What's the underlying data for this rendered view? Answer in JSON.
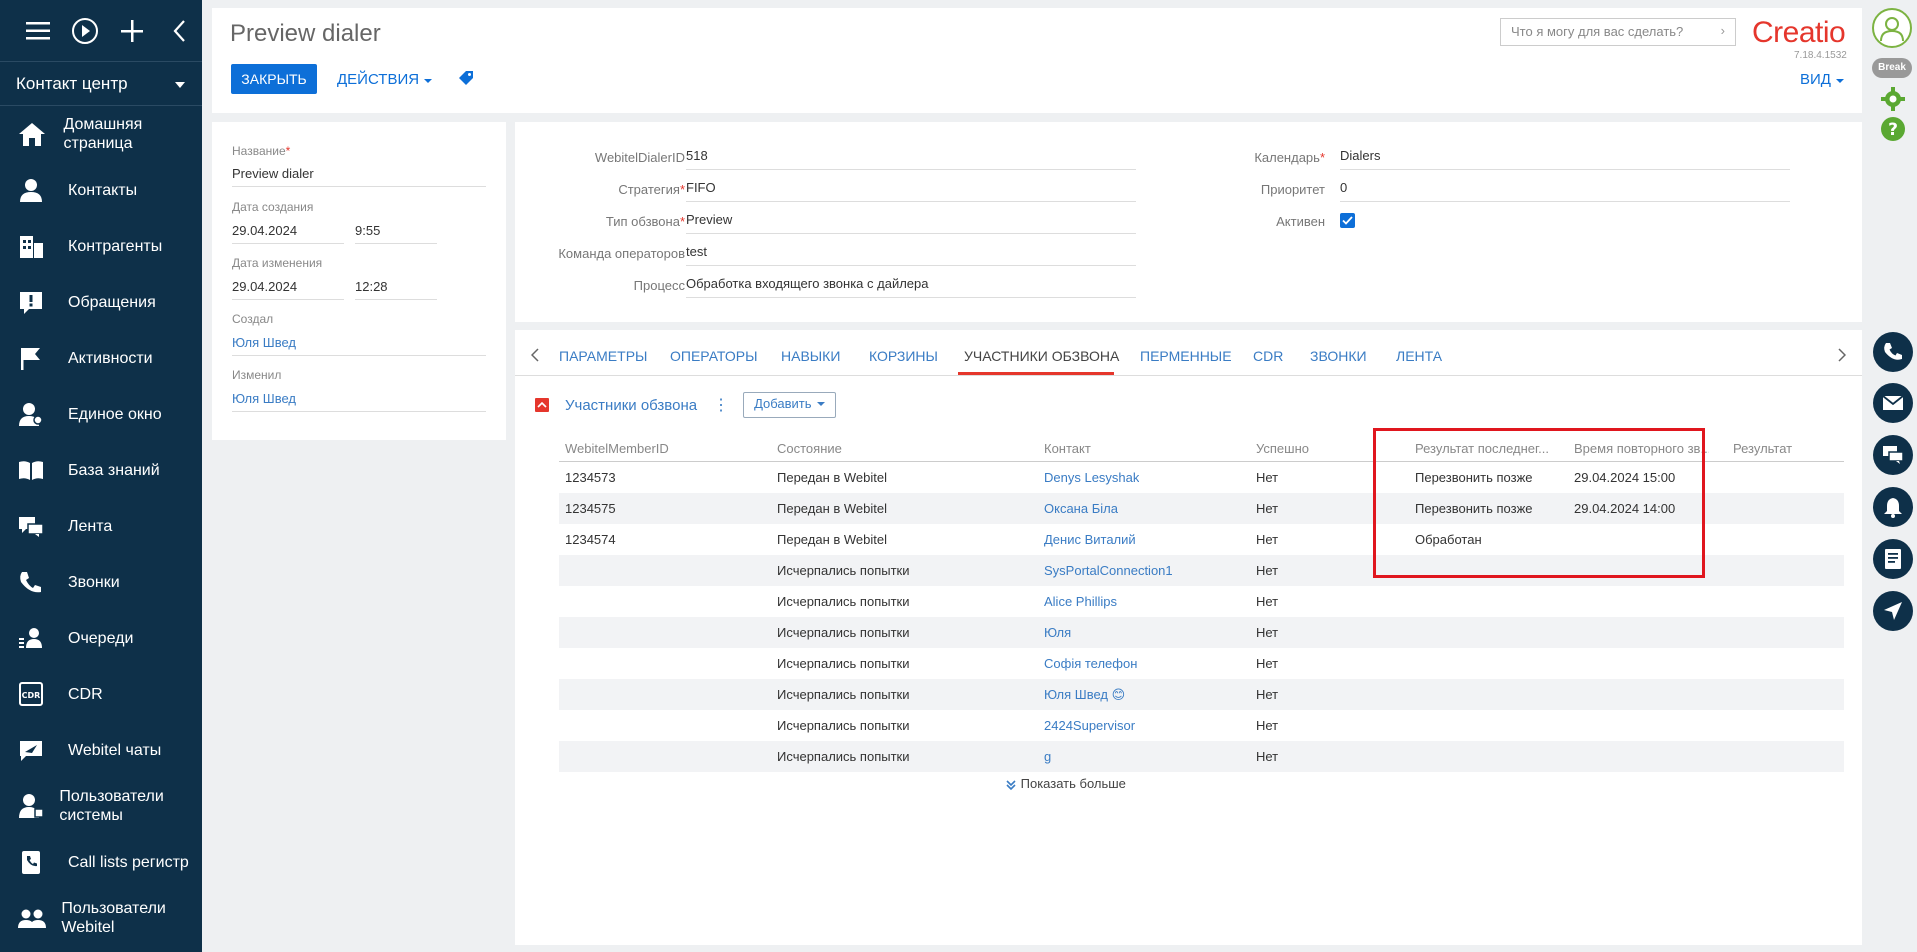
{
  "sidebar": {
    "workplace": "Контакт центр",
    "items": [
      {
        "label": "Домашняя страница",
        "icon": "home-icon"
      },
      {
        "label": "Контакты",
        "icon": "person-icon"
      },
      {
        "label": "Контрагенты",
        "icon": "building-icon"
      },
      {
        "label": "Обращения",
        "icon": "case-icon"
      },
      {
        "label": "Активности",
        "icon": "flag-icon"
      },
      {
        "label": "Единое окно",
        "icon": "single-window-icon"
      },
      {
        "label": "База знаний",
        "icon": "book-icon"
      },
      {
        "label": "Лента",
        "icon": "feed-icon"
      },
      {
        "label": "Звонки",
        "icon": "phone-icon"
      },
      {
        "label": "Очереди",
        "icon": "queue-icon"
      },
      {
        "label": "CDR",
        "icon": "cdr-icon"
      },
      {
        "label": "Webitel чаты",
        "icon": "chat-send-icon"
      },
      {
        "label": "Пользователи системы",
        "icon": "system-user-icon"
      },
      {
        "label": "Call lists регистр",
        "icon": "call-list-icon"
      },
      {
        "label": "Пользователи Webitel",
        "icon": "users-icon"
      }
    ]
  },
  "header": {
    "title": "Preview dialer",
    "close_label": "ЗАКРЫТЬ",
    "actions_label": "ДЕЙСТВИЯ",
    "view_label": "ВИД",
    "search_placeholder": "Что я могу для вас сделать?",
    "logo": "Creatio",
    "version": "7.18.4.1532"
  },
  "rightbar": {
    "break_label": "Break"
  },
  "info": {
    "name_label": "Название",
    "name_value": "Preview dialer",
    "created_label": "Дата создания",
    "created_date": "29.04.2024",
    "created_time": "9:55",
    "modified_label": "Дата изменения",
    "modified_date": "29.04.2024",
    "modified_time": "12:28",
    "created_by_label": "Создал",
    "created_by": "Юля Швед",
    "modified_by_label": "Изменил",
    "modified_by": "Юля Швед"
  },
  "fields": {
    "dialer_id_label": "WebitelDialerID",
    "dialer_id": "518",
    "strategy_label": "Стратегия",
    "strategy": "FIFO",
    "type_label": "Тип обзвона",
    "type": "Preview",
    "team_label": "Команда операторов",
    "team": "test",
    "process_label": "Процесс",
    "process": "Обработка входящего звонка с дайлера",
    "calendar_label": "Календарь",
    "calendar": "Dialers",
    "priority_label": "Приоритет",
    "priority": "0",
    "active_label": "Активен",
    "active": true
  },
  "tabs": [
    "ПАРАМЕТРЫ",
    "ОПЕРАТОРЫ",
    "НАВЫКИ",
    "КОРЗИНЫ",
    "УЧАСТНИКИ ОБЗВОНА",
    "ПЕРМЕННЫЕ",
    "CDR",
    "ЗВОНКИ",
    "ЛЕНТА"
  ],
  "active_tab": "УЧАСТНИКИ ОБЗВОНА",
  "detail": {
    "title": "Участники обзвона",
    "add_label": "Добавить",
    "show_more": "Показать больше"
  },
  "grid": {
    "columns": [
      "WebitelMemberID",
      "Состояние",
      "Контакт",
      "Успешно",
      "Результат последнег...",
      "Время повторного зв...",
      "Результат"
    ],
    "rows": [
      [
        "1234573",
        "Передан в Webitel",
        "Denys Lesyshak",
        "Нет",
        "Перезвонить позже",
        "29.04.2024 15:00",
        ""
      ],
      [
        "1234575",
        "Передан в Webitel",
        "Оксана Біла",
        "Нет",
        "Перезвонить позже",
        "29.04.2024 14:00",
        ""
      ],
      [
        "1234574",
        "Передан в Webitel",
        "Денис Виталий",
        "Нет",
        "Обработан",
        "",
        ""
      ],
      [
        "",
        "Исчерпались попытки",
        "SysPortalConnection1",
        "Нет",
        "",
        "",
        ""
      ],
      [
        "",
        "Исчерпались попытки",
        "Alice Phillips",
        "Нет",
        "",
        "",
        ""
      ],
      [
        "",
        "Исчерпались попытки",
        "Юля",
        "Нет",
        "",
        "",
        ""
      ],
      [
        "",
        "Исчерпались попытки",
        "Софія телефон",
        "Нет",
        "",
        "",
        ""
      ],
      [
        "",
        "Исчерпались попытки",
        "Юля Швед 😊",
        "Нет",
        "",
        "",
        ""
      ],
      [
        "",
        "Исчерпались попытки",
        "2424Supervisor",
        "Нет",
        "",
        "",
        ""
      ],
      [
        "",
        "Исчерпались попытки",
        "g",
        "Нет",
        "",
        "",
        ""
      ]
    ]
  },
  "colors": {
    "sidebar_bg": "#0e3049",
    "primary": "#0d6fd8",
    "accent_red": "#e5362c",
    "link": "#3a7cc4"
  }
}
